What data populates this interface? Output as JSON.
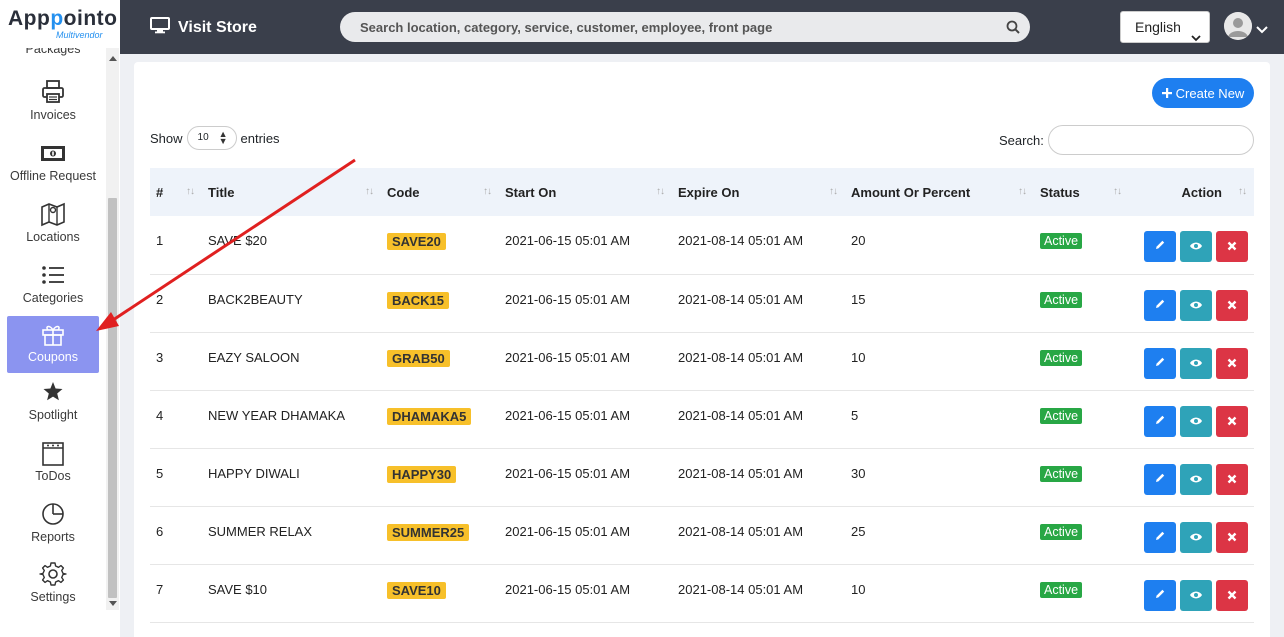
{
  "app": {
    "logo_main_a": "App",
    "logo_main_b": "p",
    "logo_main_c": "ointo",
    "logo_sub": "Multivendor"
  },
  "sidebar": {
    "partial_label": "Packages",
    "items": [
      {
        "label": "Invoices",
        "icon": "printer-icon"
      },
      {
        "label": "Offline Request",
        "icon": "cash-icon"
      },
      {
        "label": "Locations",
        "icon": "map-icon"
      },
      {
        "label": "Categories",
        "icon": "list-icon"
      },
      {
        "label": "Coupons",
        "icon": "gift-icon",
        "active": true
      },
      {
        "label": "Spotlight",
        "icon": "star-icon"
      },
      {
        "label": "ToDos",
        "icon": "notepad-icon"
      },
      {
        "label": "Reports",
        "icon": "pie-chart-icon"
      },
      {
        "label": "Settings",
        "icon": "gear-icon"
      }
    ]
  },
  "topbar": {
    "visit_store": "Visit Store",
    "search_placeholder": "Search location, category, service, customer, employee, front page",
    "language": "English"
  },
  "page": {
    "create_label": "Create New",
    "show_label": "Show",
    "entries_value": "10",
    "entries_label": "entries",
    "search_label": "Search:"
  },
  "table": {
    "columns": [
      "#",
      "Title",
      "Code",
      "Start On",
      "Expire On",
      "Amount Or Percent",
      "Status",
      "Action"
    ],
    "rows": [
      {
        "num": "1",
        "title": "SAVE $20",
        "code": "SAVE20",
        "start": "2021-06-15 05:01 AM",
        "expire": "2021-08-14 05:01 AM",
        "amount": "20",
        "status": "Active"
      },
      {
        "num": "2",
        "title": "BACK2BEAUTY",
        "code": "BACK15",
        "start": "2021-06-15 05:01 AM",
        "expire": "2021-08-14 05:01 AM",
        "amount": "15",
        "status": "Active"
      },
      {
        "num": "3",
        "title": "EAZY SALOON",
        "code": "GRAB50",
        "start": "2021-06-15 05:01 AM",
        "expire": "2021-08-14 05:01 AM",
        "amount": "10",
        "status": "Active"
      },
      {
        "num": "4",
        "title": "NEW YEAR DHAMAKA",
        "code": "DHAMAKA5",
        "start": "2021-06-15 05:01 AM",
        "expire": "2021-08-14 05:01 AM",
        "amount": "5",
        "status": "Active"
      },
      {
        "num": "5",
        "title": "HAPPY DIWALI",
        "code": "HAPPY30",
        "start": "2021-06-15 05:01 AM",
        "expire": "2021-08-14 05:01 AM",
        "amount": "30",
        "status": "Active"
      },
      {
        "num": "6",
        "title": "SUMMER RELAX",
        "code": "SUMMER25",
        "start": "2021-06-15 05:01 AM",
        "expire": "2021-08-14 05:01 AM",
        "amount": "25",
        "status": "Active"
      },
      {
        "num": "7",
        "title": "SAVE $10",
        "code": "SAVE10",
        "start": "2021-06-15 05:01 AM",
        "expire": "2021-08-14 05:01 AM",
        "amount": "10",
        "status": "Active"
      }
    ]
  },
  "colors": {
    "topbar": "#3a3f4b",
    "accent": "#1e7ff0",
    "active_nav": "#8b94f0",
    "badge": "#f7c02a",
    "status": "#28a745",
    "arrow": "#e02020"
  }
}
